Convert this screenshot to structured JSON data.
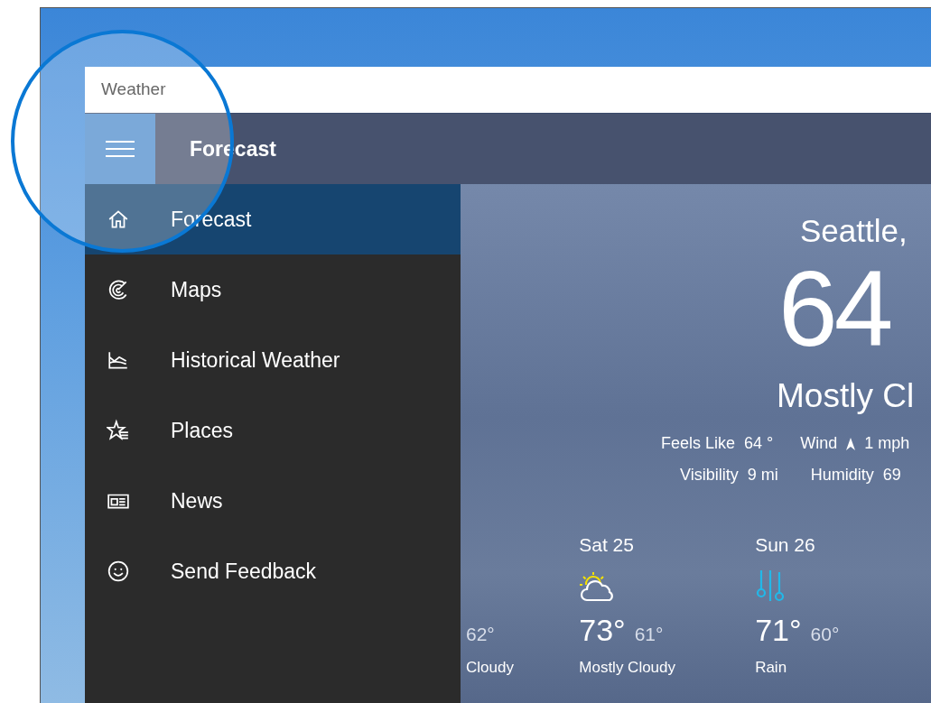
{
  "window": {
    "title": "Weather"
  },
  "header": {
    "title": "Forecast"
  },
  "sidebar": {
    "items": [
      {
        "label": "Forecast",
        "kind": "home",
        "selected": true
      },
      {
        "label": "Maps",
        "kind": "radar",
        "selected": false
      },
      {
        "label": "Historical Weather",
        "kind": "chart",
        "selected": false
      },
      {
        "label": "Places",
        "kind": "star",
        "selected": false
      },
      {
        "label": "News",
        "kind": "news",
        "selected": false
      },
      {
        "label": "Send Feedback",
        "kind": "smile",
        "selected": false
      }
    ]
  },
  "current": {
    "location": "Seattle,",
    "temperature": "64",
    "condition": "Mostly Cl",
    "details": [
      [
        {
          "label": "Feels Like",
          "value": "64 °",
          "kind": "plain"
        },
        {
          "label": "Wind",
          "value": "1 mph",
          "kind": "wind"
        }
      ],
      [
        {
          "label": "Visibility",
          "value": "9 mi",
          "kind": "plain"
        },
        {
          "label": "Humidity",
          "value": "69",
          "kind": "plain"
        }
      ]
    ]
  },
  "forecast": [
    {
      "kind": "partial",
      "low": "62°",
      "condition": "Cloudy"
    },
    {
      "day": "Sat 25",
      "kind": "partly-cloudy",
      "high": "73°",
      "low": "61°",
      "condition": "Mostly Cloudy"
    },
    {
      "day": "Sun 26",
      "kind": "rain",
      "high": "71°",
      "low": "60°",
      "condition": "Rain"
    }
  ]
}
